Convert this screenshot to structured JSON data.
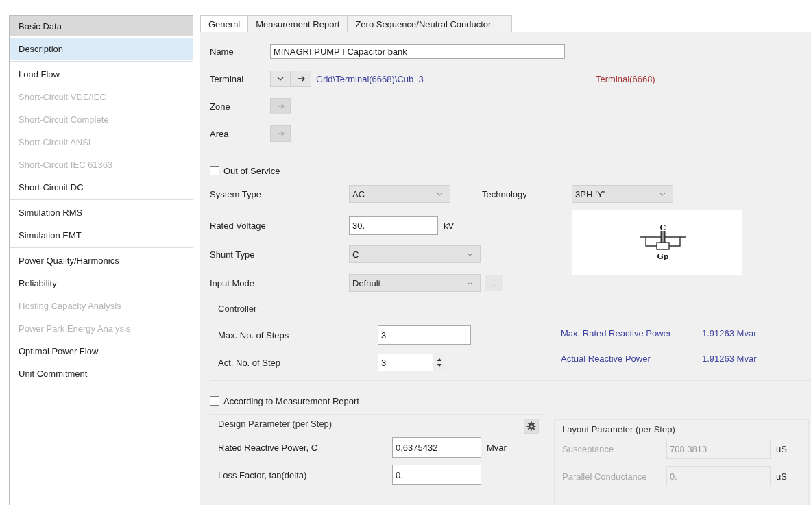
{
  "sidebar": {
    "header": "Basic Data",
    "groups": [
      [
        {
          "label": "Description",
          "selected": true,
          "disabled": false
        }
      ],
      [
        {
          "label": "Load Flow",
          "selected": false,
          "disabled": false
        },
        {
          "label": "Short-Circuit VDE/IEC",
          "selected": false,
          "disabled": true
        },
        {
          "label": "Short-Circuit Complete",
          "selected": false,
          "disabled": true
        },
        {
          "label": "Short-Circuit ANSI",
          "selected": false,
          "disabled": true
        },
        {
          "label": "Short-Circuit IEC 61363",
          "selected": false,
          "disabled": true
        },
        {
          "label": "Short-Circuit DC",
          "selected": false,
          "disabled": false
        }
      ],
      [
        {
          "label": "Simulation RMS",
          "selected": false,
          "disabled": false
        },
        {
          "label": "Simulation EMT",
          "selected": false,
          "disabled": false
        }
      ],
      [
        {
          "label": "Power Quality/Harmonics",
          "selected": false,
          "disabled": false
        },
        {
          "label": "Reliability",
          "selected": false,
          "disabled": false
        },
        {
          "label": "Hosting Capacity Analysis",
          "selected": false,
          "disabled": true
        },
        {
          "label": "Power Park Energy Analysis",
          "selected": false,
          "disabled": true
        },
        {
          "label": "Optimal Power Flow",
          "selected": false,
          "disabled": false
        },
        {
          "label": "Unit Commitment",
          "selected": false,
          "disabled": false
        }
      ]
    ]
  },
  "tabs": [
    {
      "label": "General",
      "selected": true
    },
    {
      "label": "Measurement Report",
      "selected": false
    },
    {
      "label": "Zero Sequence/Neutral Conductor",
      "selected": false
    }
  ],
  "name": {
    "label": "Name",
    "value": "MINAGRI PUMP I Capacitor bank"
  },
  "terminal": {
    "label": "Terminal",
    "path": "Grid\\Terminal(6668)\\Cub_3",
    "target": "Terminal(6668)"
  },
  "zone": {
    "label": "Zone",
    "disabled": true
  },
  "area": {
    "label": "Area",
    "disabled": true
  },
  "out_of_service": {
    "label": "Out of Service",
    "checked": false
  },
  "system_type": {
    "label": "System Type",
    "value": "AC"
  },
  "technology": {
    "label": "Technology",
    "value": "3PH-'Y'"
  },
  "rated_voltage": {
    "label": "Rated Voltage",
    "value": "30.",
    "unit": "kV"
  },
  "shunt_type": {
    "label": "Shunt Type",
    "value": "C"
  },
  "input_mode": {
    "label": "Input Mode",
    "value": "Default",
    "more": "..."
  },
  "diagram": {
    "capacitor": "C",
    "conductance": "Gp"
  },
  "controller": {
    "title": "Controller",
    "max_steps": {
      "label": "Max. No. of Steps",
      "value": "3"
    },
    "act_step": {
      "label": "Act. No. of Step",
      "value": "3"
    },
    "results": [
      {
        "label": "Max. Rated Reactive Power",
        "value": "1.91263 Mvar"
      },
      {
        "label": "Actual Reactive Power",
        "value": "1.91263 Mvar"
      }
    ]
  },
  "according": {
    "label": "According to Measurement Report",
    "checked": false
  },
  "design": {
    "title": "Design Parameter (per Step)",
    "rows": [
      {
        "label": "Rated Reactive Power, C",
        "value": "0.6375432",
        "unit": "Mvar"
      },
      {
        "label": "Loss Factor, tan(delta)",
        "value": "0."
      }
    ]
  },
  "layout": {
    "title": "Layout Parameter (per Step)",
    "rows": [
      {
        "label": "Susceptance",
        "value": "708.3813",
        "unit": "uS",
        "disabled": true
      },
      {
        "label": "Parallel Conductance",
        "value": "0.",
        "unit": "uS",
        "disabled": true
      }
    ]
  }
}
